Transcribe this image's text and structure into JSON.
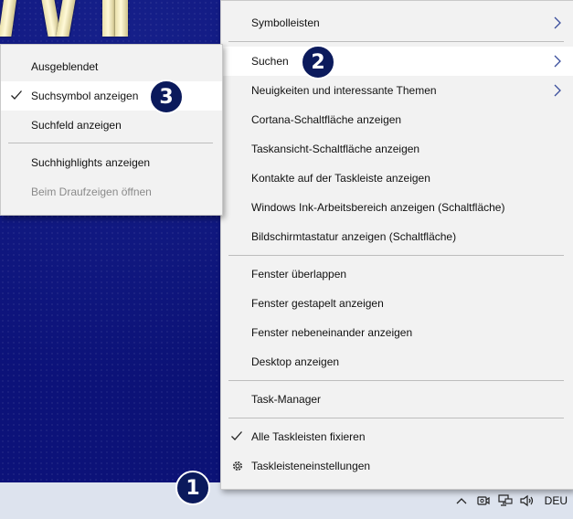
{
  "taskbar": {
    "language": "DEU",
    "tray_icons": [
      "chevron-up-icon",
      "meet-now-icon",
      "network-icon",
      "volume-icon"
    ]
  },
  "context_menu": {
    "items": [
      {
        "label": "Symbolleisten",
        "submenu": true
      },
      {
        "label": "Suchen",
        "submenu": true,
        "highlighted": true
      },
      {
        "label": "Neuigkeiten und interessante Themen",
        "submenu": true
      },
      {
        "label": "Cortana-Schaltfläche anzeigen"
      },
      {
        "label": "Taskansicht-Schaltfläche anzeigen"
      },
      {
        "label": "Kontakte auf der Taskleiste anzeigen"
      },
      {
        "label": "Windows Ink-Arbeitsbereich anzeigen (Schaltfläche)"
      },
      {
        "label": "Bildschirmtastatur anzeigen (Schaltfläche)"
      },
      {
        "label": "Fenster überlappen"
      },
      {
        "label": "Fenster gestapelt anzeigen"
      },
      {
        "label": "Fenster nebeneinander anzeigen"
      },
      {
        "label": "Desktop anzeigen"
      },
      {
        "label": "Task-Manager"
      },
      {
        "label": "Alle Taskleisten fixieren",
        "checked": true
      },
      {
        "label": "Taskleisteneinstellungen",
        "icon": "gear-icon"
      }
    ]
  },
  "search_submenu": {
    "items": [
      {
        "label": "Ausgeblendet"
      },
      {
        "label": "Suchsymbol anzeigen",
        "checked": true,
        "highlighted": true
      },
      {
        "label": "Suchfeld anzeigen"
      },
      {
        "label": "Suchhighlights anzeigen"
      },
      {
        "label": "Beim Draufzeigen öffnen",
        "disabled": true
      }
    ]
  },
  "callouts": [
    "1",
    "2",
    "3"
  ],
  "colors": {
    "menu_bg": "#f2f2f2",
    "highlight": "#ffffff",
    "taskbar": "#dde3ee",
    "badge": "#0b1a5c",
    "desktop": "#0c1279"
  }
}
